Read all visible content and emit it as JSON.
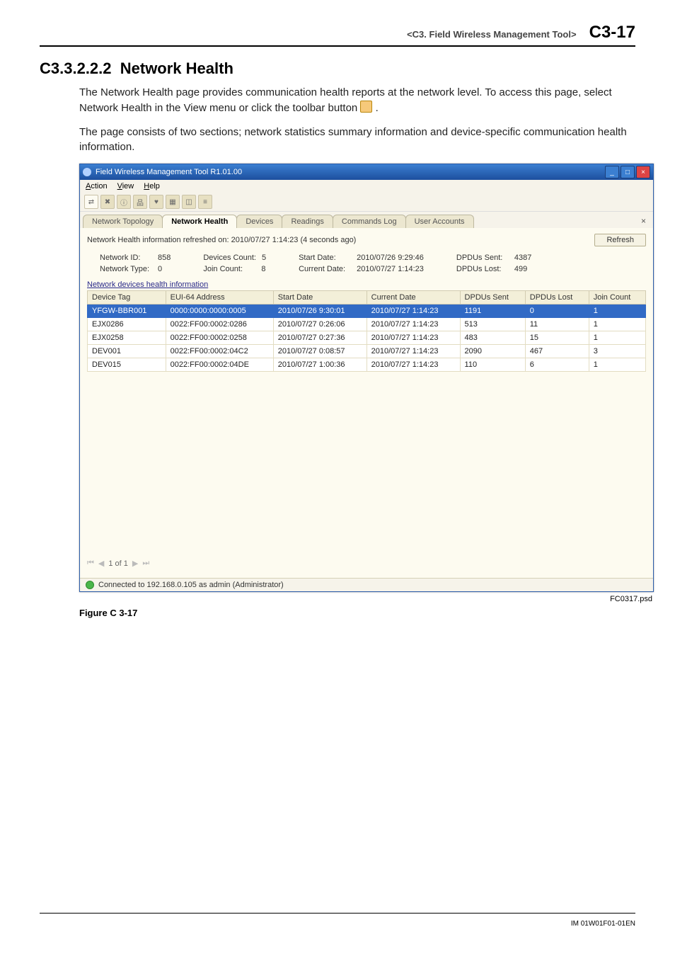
{
  "header": {
    "breadcrumb": "<C3.  Field Wireless Management Tool>",
    "page_num": "C3-17"
  },
  "section": {
    "num": "C3.3.2.2.2",
    "title": "Network Health"
  },
  "para1": "The Network Health page provides communication health reports at the network level. To access this page, select Network Health in the View menu or click the toolbar button ",
  "para1_tail": " .",
  "para2": "The page consists of two sections; network statistics summary information and device-specific communication health information.",
  "win": {
    "title": "Field Wireless Management Tool R1.01.00",
    "menus": [
      "Action",
      "View",
      "Help"
    ],
    "tabs": [
      "Network Topology",
      "Network Health",
      "Devices",
      "Readings",
      "Commands Log",
      "User Accounts"
    ],
    "active_tab": 1,
    "info_line": "Network Health information refreshed on:  2010/07/27 1:14:23  (4 seconds ago)",
    "refresh": "Refresh",
    "summary": {
      "c0": [
        {
          "lab": "Network ID:",
          "val": "858"
        },
        {
          "lab": "Network Type:",
          "val": "0"
        }
      ],
      "c1": [
        {
          "lab": "Devices Count:",
          "val": "5"
        },
        {
          "lab": "Join Count:",
          "val": "8"
        }
      ],
      "c2": [
        {
          "lab": "Start Date:",
          "val": "2010/07/26 9:29:46"
        },
        {
          "lab": "Current Date:",
          "val": "2010/07/27 1:14:23"
        }
      ],
      "c3": [
        {
          "lab": "DPDUs Sent:",
          "val": "4387"
        },
        {
          "lab": "DPDUs Lost:",
          "val": "499"
        }
      ]
    },
    "section_link": "Network devices health information",
    "grid_headers": [
      "Device Tag",
      "EUI-64 Address",
      "Start Date",
      "Current Date",
      "DPDUs Sent",
      "DPDUs Lost",
      "Join Count"
    ],
    "rows": [
      {
        "sel": true,
        "c": [
          "YFGW-BBR001",
          "0000:0000:0000:0005",
          "2010/07/26 9:30:01",
          "2010/07/27 1:14:23",
          "1191",
          "0",
          "1"
        ]
      },
      {
        "sel": false,
        "c": [
          "EJX0286",
          "0022:FF00:0002:0286",
          "2010/07/27 0:26:06",
          "2010/07/27 1:14:23",
          "513",
          "11",
          "1"
        ]
      },
      {
        "sel": false,
        "c": [
          "EJX0258",
          "0022:FF00:0002:0258",
          "2010/07/27 0:27:36",
          "2010/07/27 1:14:23",
          "483",
          "15",
          "1"
        ]
      },
      {
        "sel": false,
        "c": [
          "DEV001",
          "0022:FF00:0002:04C2",
          "2010/07/27 0:08:57",
          "2010/07/27 1:14:23",
          "2090",
          "467",
          "3"
        ]
      },
      {
        "sel": false,
        "c": [
          "DEV015",
          "0022:FF00:0002:04DE",
          "2010/07/27 1:00:36",
          "2010/07/27 1:14:23",
          "110",
          "6",
          "1"
        ]
      }
    ],
    "pager": "1 of 1",
    "status": "Connected to 192.168.0.105 as admin (Administrator)"
  },
  "img_id": "FC0317.psd",
  "fig_caption": "Figure C 3-17",
  "footer": "IM 01W01F01-01EN"
}
